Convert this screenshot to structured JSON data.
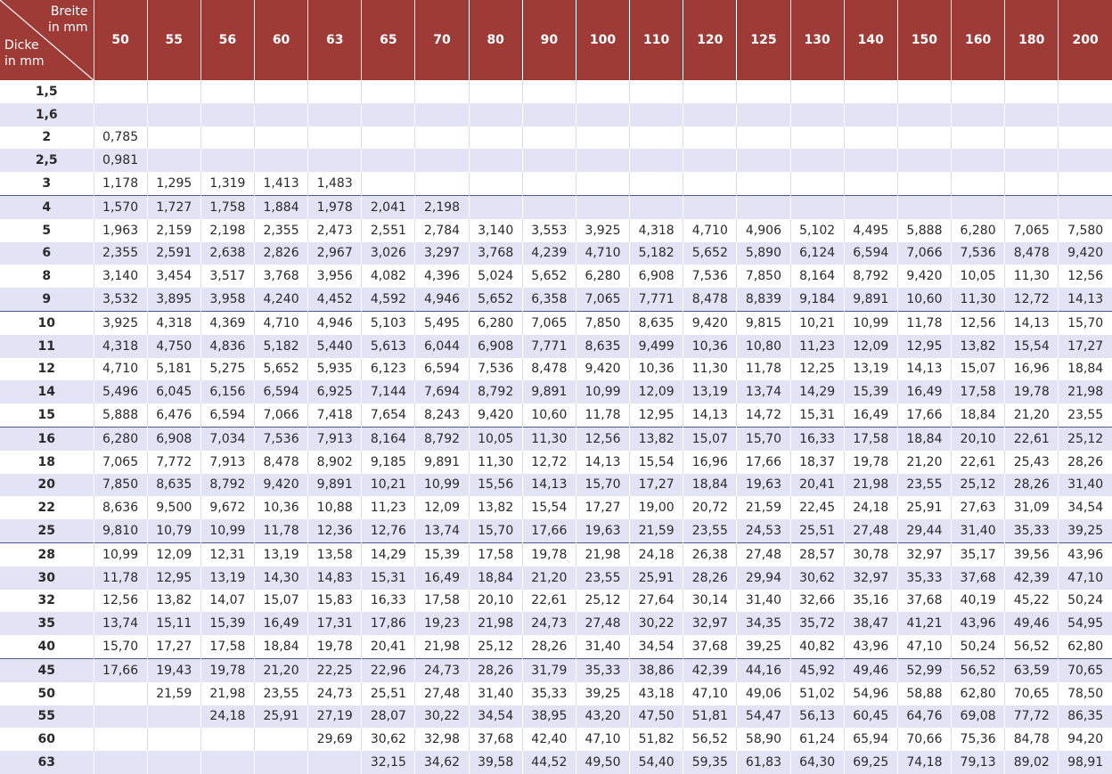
{
  "header": {
    "corner_top": [
      "Breite",
      "in mm"
    ],
    "corner_bottom": [
      "Dicke",
      "in mm"
    ],
    "widths": [
      "50",
      "55",
      "56",
      "60",
      "63",
      "65",
      "70",
      "80",
      "90",
      "100",
      "110",
      "120",
      "125",
      "130",
      "140",
      "150",
      "160",
      "180",
      "200"
    ]
  },
  "colors": {
    "header_bg": "#9e3b37",
    "stripe": "#e2e3f5",
    "group_line": "#4a5a8a"
  },
  "rows": [
    {
      "thickness": "1,5",
      "values": [
        "",
        "",
        "",
        "",
        "",
        "",
        "",
        "",
        "",
        "",
        "",
        "",
        "",
        "",
        "",
        "",
        "",
        "",
        ""
      ]
    },
    {
      "thickness": "1,6",
      "values": [
        "",
        "",
        "",
        "",
        "",
        "",
        "",
        "",
        "",
        "",
        "",
        "",
        "",
        "",
        "",
        "",
        "",
        "",
        ""
      ]
    },
    {
      "thickness": "2",
      "values": [
        "0,785",
        "",
        "",
        "",
        "",
        "",
        "",
        "",
        "",
        "",
        "",
        "",
        "",
        "",
        "",
        "",
        "",
        "",
        ""
      ]
    },
    {
      "thickness": "2,5",
      "values": [
        "0,981",
        "",
        "",
        "",
        "",
        "",
        "",
        "",
        "",
        "",
        "",
        "",
        "",
        "",
        "",
        "",
        "",
        "",
        ""
      ]
    },
    {
      "thickness": "3",
      "values": [
        "1,178",
        "1,295",
        "1,319",
        "1,413",
        "1,483",
        "",
        "",
        "",
        "",
        "",
        "",
        "",
        "",
        "",
        "",
        "",
        "",
        "",
        ""
      ]
    },
    {
      "thickness": "4",
      "values": [
        "1,570",
        "1,727",
        "1,758",
        "1,884",
        "1,978",
        "2,041",
        "2,198",
        "",
        "",
        "",
        "",
        "",
        "",
        "",
        "",
        "",
        "",
        "",
        ""
      ]
    },
    {
      "thickness": "5",
      "values": [
        "1,963",
        "2,159",
        "2,198",
        "2,355",
        "2,473",
        "2,551",
        "2,784",
        "3,140",
        "3,553",
        "3,925",
        "4,318",
        "4,710",
        "4,906",
        "5,102",
        "4,495",
        "5,888",
        "6,280",
        "7,065",
        "7,580"
      ]
    },
    {
      "thickness": "6",
      "values": [
        "2,355",
        "2,591",
        "2,638",
        "2,826",
        "2,967",
        "3,026",
        "3,297",
        "3,768",
        "4,239",
        "4,710",
        "5,182",
        "5,652",
        "5,890",
        "6,124",
        "6,594",
        "7,066",
        "7,536",
        "8,478",
        "9,420"
      ]
    },
    {
      "thickness": "8",
      "values": [
        "3,140",
        "3,454",
        "3,517",
        "3,768",
        "3,956",
        "4,082",
        "4,396",
        "5,024",
        "5,652",
        "6,280",
        "6,908",
        "7,536",
        "7,850",
        "8,164",
        "8,792",
        "9,420",
        "10,05",
        "11,30",
        "12,56"
      ]
    },
    {
      "thickness": "9",
      "values": [
        "3,532",
        "3,895",
        "3,958",
        "4,240",
        "4,452",
        "4,592",
        "4,946",
        "5,652",
        "6,358",
        "7,065",
        "7,771",
        "8,478",
        "8,839",
        "9,184",
        "9,891",
        "10,60",
        "11,30",
        "12,72",
        "14,13"
      ]
    },
    {
      "thickness": "10",
      "values": [
        "3,925",
        "4,318",
        "4,369",
        "4,710",
        "4,946",
        "5,103",
        "5,495",
        "6,280",
        "7,065",
        "7,850",
        "8,635",
        "9,420",
        "9,815",
        "10,21",
        "10,99",
        "11,78",
        "12,56",
        "14,13",
        "15,70"
      ]
    },
    {
      "thickness": "11",
      "values": [
        "4,318",
        "4,750",
        "4,836",
        "5,182",
        "5,440",
        "5,613",
        "6,044",
        "6,908",
        "7,771",
        "8,635",
        "9,499",
        "10,36",
        "10,80",
        "11,23",
        "12,09",
        "12,95",
        "13,82",
        "15,54",
        "17,27"
      ]
    },
    {
      "thickness": "12",
      "values": [
        "4,710",
        "5,181",
        "5,275",
        "5,652",
        "5,935",
        "6,123",
        "6,594",
        "7,536",
        "8,478",
        "9,420",
        "10,36",
        "11,30",
        "11,78",
        "12,25",
        "13,19",
        "14,13",
        "15,07",
        "16,96",
        "18,84"
      ]
    },
    {
      "thickness": "14",
      "values": [
        "5,496",
        "6,045",
        "6,156",
        "6,594",
        "6,925",
        "7,144",
        "7,694",
        "8,792",
        "9,891",
        "10,99",
        "12,09",
        "13,19",
        "13,74",
        "14,29",
        "15,39",
        "16,49",
        "17,58",
        "19,78",
        "21,98"
      ]
    },
    {
      "thickness": "15",
      "values": [
        "5,888",
        "6,476",
        "6,594",
        "7,066",
        "7,418",
        "7,654",
        "8,243",
        "9,420",
        "10,60",
        "11,78",
        "12,95",
        "14,13",
        "14,72",
        "15,31",
        "16,49",
        "17,66",
        "18,84",
        "21,20",
        "23,55"
      ]
    },
    {
      "thickness": "16",
      "values": [
        "6,280",
        "6,908",
        "7,034",
        "7,536",
        "7,913",
        "8,164",
        "8,792",
        "10,05",
        "11,30",
        "12,56",
        "13,82",
        "15,07",
        "15,70",
        "16,33",
        "17,58",
        "18,84",
        "20,10",
        "22,61",
        "25,12"
      ]
    },
    {
      "thickness": "18",
      "values": [
        "7,065",
        "7,772",
        "7,913",
        "8,478",
        "8,902",
        "9,185",
        "9,891",
        "11,30",
        "12,72",
        "14,13",
        "15,54",
        "16,96",
        "17,66",
        "18,37",
        "19,78",
        "21,20",
        "22,61",
        "25,43",
        "28,26"
      ]
    },
    {
      "thickness": "20",
      "values": [
        "7,850",
        "8,635",
        "8,792",
        "9,420",
        "9,891",
        "10,21",
        "10,99",
        "15,56",
        "14,13",
        "15,70",
        "17,27",
        "18,84",
        "19,63",
        "20,41",
        "21,98",
        "23,55",
        "25,12",
        "28,26",
        "31,40"
      ]
    },
    {
      "thickness": "22",
      "values": [
        "8,636",
        "9,500",
        "9,672",
        "10,36",
        "10,88",
        "11,23",
        "12,09",
        "13,82",
        "15,54",
        "17,27",
        "19,00",
        "20,72",
        "21,59",
        "22,45",
        "24,18",
        "25,91",
        "27,63",
        "31,09",
        "34,54"
      ]
    },
    {
      "thickness": "25",
      "values": [
        "9,810",
        "10,79",
        "10,99",
        "11,78",
        "12,36",
        "12,76",
        "13,74",
        "15,70",
        "17,66",
        "19,63",
        "21,59",
        "23,55",
        "24,53",
        "25,51",
        "27,48",
        "29,44",
        "31,40",
        "35,33",
        "39,25"
      ]
    },
    {
      "thickness": "28",
      "values": [
        "10,99",
        "12,09",
        "12,31",
        "13,19",
        "13,58",
        "14,29",
        "15,39",
        "17,58",
        "19,78",
        "21,98",
        "24,18",
        "26,38",
        "27,48",
        "28,57",
        "30,78",
        "32,97",
        "35,17",
        "39,56",
        "43,96"
      ]
    },
    {
      "thickness": "30",
      "values": [
        "11,78",
        "12,95",
        "13,19",
        "14,30",
        "14,83",
        "15,31",
        "16,49",
        "18,84",
        "21,20",
        "23,55",
        "25,91",
        "28,26",
        "29,94",
        "30,62",
        "32,97",
        "35,33",
        "37,68",
        "42,39",
        "47,10"
      ]
    },
    {
      "thickness": "32",
      "values": [
        "12,56",
        "13,82",
        "14,07",
        "15,07",
        "15,83",
        "16,33",
        "17,58",
        "20,10",
        "22,61",
        "25,12",
        "27,64",
        "30,14",
        "31,40",
        "32,66",
        "35,16",
        "37,68",
        "40,19",
        "45,22",
        "50,24"
      ]
    },
    {
      "thickness": "35",
      "values": [
        "13,74",
        "15,11",
        "15,39",
        "16,49",
        "17,31",
        "17,86",
        "19,23",
        "21,98",
        "24,73",
        "27,48",
        "30,22",
        "32,97",
        "34,35",
        "35,72",
        "38,47",
        "41,21",
        "43,96",
        "49,46",
        "54,95"
      ]
    },
    {
      "thickness": "40",
      "values": [
        "15,70",
        "17,27",
        "17,58",
        "18,84",
        "19,78",
        "20,41",
        "21,98",
        "25,12",
        "28,26",
        "31,40",
        "34,54",
        "37,68",
        "39,25",
        "40,82",
        "43,96",
        "47,10",
        "50,24",
        "56,52",
        "62,80"
      ]
    },
    {
      "thickness": "45",
      "values": [
        "17,66",
        "19,43",
        "19,78",
        "21,20",
        "22,25",
        "22,96",
        "24,73",
        "28,26",
        "31,79",
        "35,33",
        "38,86",
        "42,39",
        "44,16",
        "45,92",
        "49,46",
        "52,99",
        "56,52",
        "63,59",
        "70,65"
      ]
    },
    {
      "thickness": "50",
      "values": [
        "",
        "21,59",
        "21,98",
        "23,55",
        "24,73",
        "25,51",
        "27,48",
        "31,40",
        "35,33",
        "39,25",
        "43,18",
        "47,10",
        "49,06",
        "51,02",
        "54,96",
        "58,88",
        "62,80",
        "70,65",
        "78,50"
      ]
    },
    {
      "thickness": "55",
      "values": [
        "",
        "",
        "24,18",
        "25,91",
        "27,19",
        "28,07",
        "30,22",
        "34,54",
        "38,95",
        "43,20",
        "47,50",
        "51,81",
        "54,47",
        "56,13",
        "60,45",
        "64,76",
        "69,08",
        "77,72",
        "86,35"
      ]
    },
    {
      "thickness": "60",
      "values": [
        "",
        "",
        "",
        "",
        "29,69",
        "30,62",
        "32,98",
        "37,68",
        "42,40",
        "47,10",
        "51,82",
        "56,52",
        "58,90",
        "61,24",
        "65,94",
        "70,66",
        "75,36",
        "84,78",
        "94,20"
      ]
    },
    {
      "thickness": "63",
      "values": [
        "",
        "",
        "",
        "",
        "",
        "32,15",
        "34,62",
        "39,58",
        "44,52",
        "49,50",
        "54,40",
        "59,35",
        "61,83",
        "64,30",
        "69,25",
        "74,18",
        "79,13",
        "89,02",
        "98,91"
      ]
    }
  ]
}
